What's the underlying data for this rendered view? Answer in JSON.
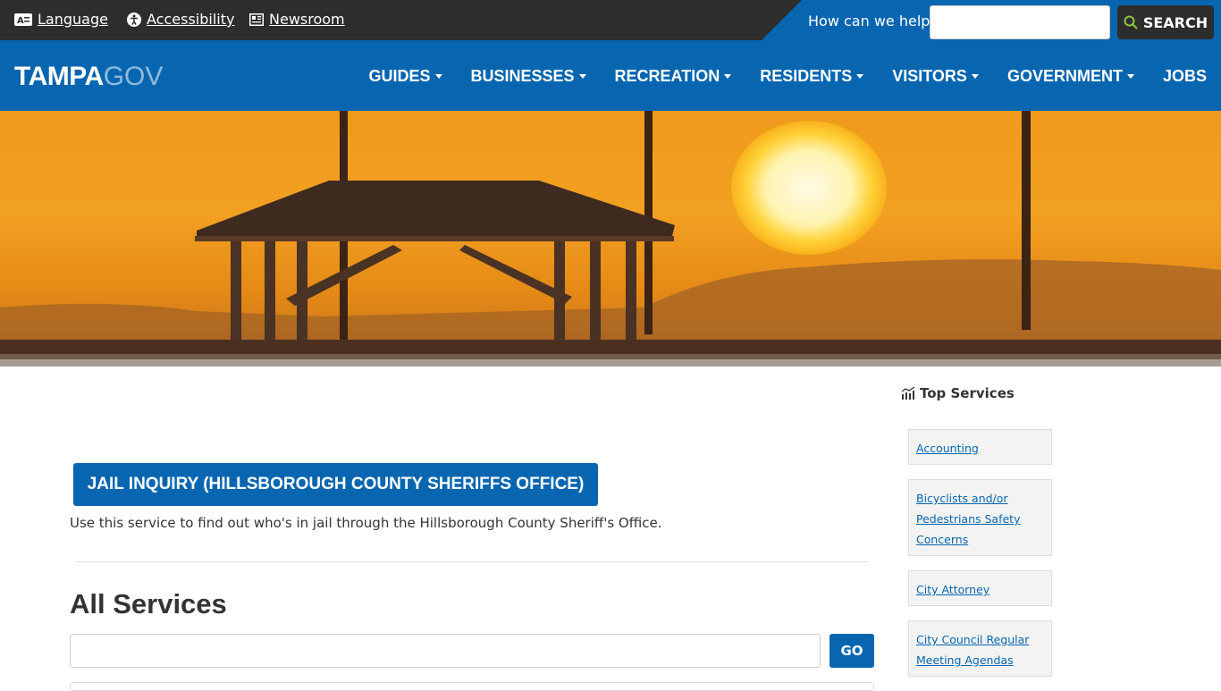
{
  "utility": {
    "links": [
      {
        "label": "Language",
        "icon": "language-icon"
      },
      {
        "label": "Accessibility",
        "icon": "accessibility-icon"
      },
      {
        "label": "Newsroom",
        "icon": "newsroom-icon"
      }
    ],
    "help_label": "How can we help?",
    "search_label": "SEARCH"
  },
  "brand": {
    "name_bold": "TAMPA",
    "name_light": "GOV"
  },
  "nav": {
    "items": [
      {
        "label": "GUIDES",
        "has_menu": true
      },
      {
        "label": "BUSINESSES",
        "has_menu": true
      },
      {
        "label": "RECREATION",
        "has_menu": true
      },
      {
        "label": "RESIDENTS",
        "has_menu": true
      },
      {
        "label": "VISITORS",
        "has_menu": true
      },
      {
        "label": "GOVERNMENT",
        "has_menu": true
      },
      {
        "label": "JOBS",
        "has_menu": false
      }
    ]
  },
  "main": {
    "service_button": "JAIL INQUIRY (HILLSBOROUGH COUNTY SHERIFFS OFFICE)",
    "service_description": "Use this service to find out who's in jail through the Hillsborough County Sheriff's Office.",
    "all_services_title": "All Services",
    "go_label": "GO"
  },
  "sidebar": {
    "title": "Top Services",
    "services": [
      {
        "lines": [
          "Accounting"
        ]
      },
      {
        "lines": [
          "Bicyclists and/or",
          "Pedestrians Safety",
          "Concerns"
        ]
      },
      {
        "lines": [
          "City Attorney"
        ]
      },
      {
        "lines": [
          "City Council Regular",
          "Meeting Agendas"
        ]
      }
    ]
  },
  "colors": {
    "brand_blue": "#0866b0",
    "dark_bar": "#2d2d2d",
    "search_icon": "#8dc63f"
  }
}
